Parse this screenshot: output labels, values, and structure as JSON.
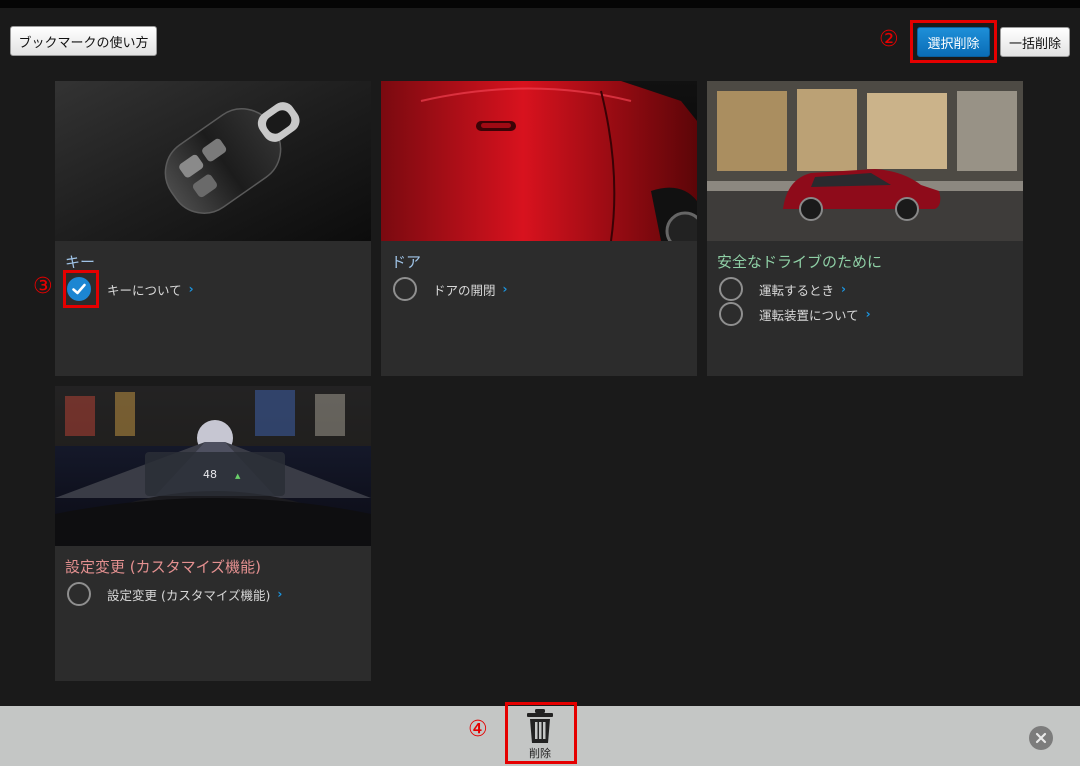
{
  "toolbar": {
    "howto_label": "ブックマークの使い方",
    "select_delete_label": "選択削除",
    "bulk_delete_label": "一括削除"
  },
  "markers": {
    "m2": "②",
    "m3": "③",
    "m4": "④"
  },
  "cards": [
    {
      "title": "キー",
      "title_color": "#9fc3e6",
      "items": [
        {
          "label": "キーについて",
          "checked": true
        }
      ]
    },
    {
      "title": "ドア",
      "title_color": "#9fc3e6",
      "items": [
        {
          "label": "ドアの開閉",
          "checked": false
        }
      ]
    },
    {
      "title": "安全なドライブのために",
      "title_color": "#8fd0a6",
      "items": [
        {
          "label": "運転するとき",
          "checked": false
        },
        {
          "label": "運転装置について",
          "checked": false
        }
      ]
    },
    {
      "title": "設定変更 (カスタマイズ機能)",
      "title_color": "#e49090",
      "items": [
        {
          "label": "設定変更 (カスタマイズ機能)",
          "checked": false
        }
      ]
    }
  ],
  "bottom": {
    "delete_label": "削除"
  },
  "colors": {
    "accent": "#1c86d2",
    "annotation": "#e50000"
  },
  "icons": {
    "trash": "trash-icon",
    "close": "close-icon",
    "check": "check-icon",
    "chevron": "chevron-right-icon"
  }
}
